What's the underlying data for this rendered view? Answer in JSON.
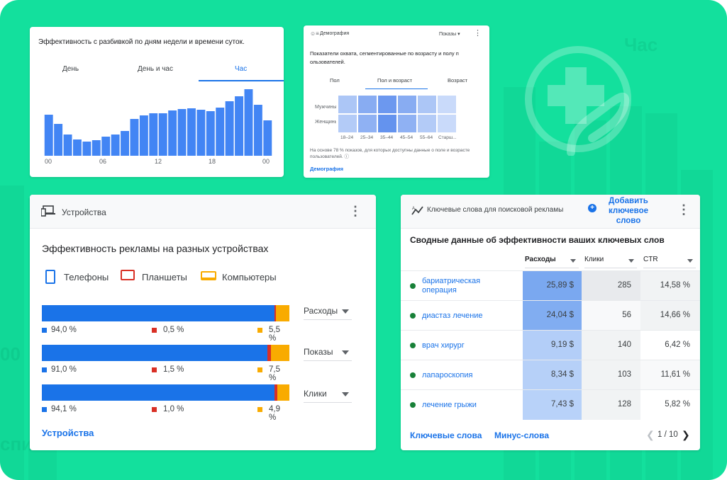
{
  "background": {
    "color": "#13e09d",
    "faint_texts": [
      "Час",
      "00",
      "спи"
    ]
  },
  "hourly_card": {
    "title": "Эффективность с разбивкой по дням недели и времени суток.",
    "tabs": [
      "День",
      "День и час",
      "Час"
    ],
    "active_tab": "Час",
    "x_ticks": [
      "00",
      "06",
      "12",
      "18",
      "00"
    ],
    "bars": [
      0.58,
      0.45,
      0.3,
      0.23,
      0.2,
      0.22,
      0.27,
      0.3,
      0.35,
      0.52,
      0.57,
      0.6,
      0.6,
      0.64,
      0.66,
      0.67,
      0.65,
      0.63,
      0.68,
      0.77,
      0.84,
      0.94,
      0.72,
      0.5
    ],
    "bar_color": "#4285f4"
  },
  "demographics_card": {
    "header_icon": "people-icon",
    "title": "Демография",
    "selector": "Показы",
    "description": "Показатели охвата, сегментированные по возрасту и полу п ользователей.",
    "tabs": [
      "Пол",
      "Пол и возраст",
      "Возраст"
    ],
    "active_tab": "Пол и возраст",
    "rows": [
      "Мужчины",
      "Женщины"
    ],
    "columns": [
      "18–24",
      "25–34",
      "35–44",
      "45–54",
      "55–64",
      "Старш..."
    ],
    "heat": [
      [
        0.35,
        0.6,
        0.8,
        0.6,
        0.35,
        0.15
      ],
      [
        0.3,
        0.55,
        0.85,
        0.55,
        0.3,
        0.15
      ]
    ],
    "note": "На основе 78 % показов, для которых доступны данные о поле и возрасте пользователей.",
    "link": "Демография"
  },
  "devices_card": {
    "header_title": "Устройства",
    "subtitle": "Эффективность рекламы на разных устройствах",
    "legend": [
      {
        "label": "Телефоны",
        "color": "#1a73e8",
        "icon": "phone-icon"
      },
      {
        "label": "Планшеты",
        "color": "#d93025",
        "icon": "tablet-icon"
      },
      {
        "label": "Компьютеры",
        "color": "#f9ab00",
        "icon": "laptop-icon"
      }
    ],
    "metrics": [
      {
        "selector": "Расходы",
        "phones": 94.0,
        "tablets": 0.5,
        "computers": 5.5,
        "phones_label": "94,0 %",
        "tablets_label": "0,5 %",
        "computers_label": "5,5 %"
      },
      {
        "selector": "Показы",
        "phones": 91.0,
        "tablets": 1.5,
        "computers": 7.5,
        "phones_label": "91,0 %",
        "tablets_label": "1,5 %",
        "computers_label": "7,5 %"
      },
      {
        "selector": "Клики",
        "phones": 94.1,
        "tablets": 1.0,
        "computers": 4.9,
        "phones_label": "94,1 %",
        "tablets_label": "1,0 %",
        "computers_label": "4,9 %"
      }
    ],
    "link": "Устройства"
  },
  "keywords_card": {
    "header_title": "Ключевые слова для поисковой рекламы",
    "add_button": "Добавить ключевое слово",
    "subtitle": "Сводные данные об эффективности ваших ключевых слов",
    "columns": [
      "Расходы",
      "Клики",
      "CTR"
    ],
    "rows": [
      {
        "keyword": "бариатрическая операция",
        "cost": "25,89 $",
        "clicks": "285",
        "ctr": "14,58 %",
        "cost_level": 1.0
      },
      {
        "keyword": "диастаз лечение",
        "cost": "24,04 $",
        "clicks": "56",
        "ctr": "14,66 %",
        "cost_level": 0.92
      },
      {
        "keyword": "врач хирург",
        "cost": "9,19 $",
        "clicks": "140",
        "ctr": "6,42 %",
        "cost_level": 0.35
      },
      {
        "keyword": "лапароскопия",
        "cost": "8,34 $",
        "clicks": "103",
        "ctr": "11,61 %",
        "cost_level": 0.32
      },
      {
        "keyword": "лечение грыжи",
        "cost": "7,43 $",
        "clicks": "128",
        "ctr": "5,82 %",
        "cost_level": 0.29
      }
    ],
    "footer_links": [
      "Ключевые слова",
      "Минус-слова"
    ],
    "pager": "1 / 10"
  }
}
